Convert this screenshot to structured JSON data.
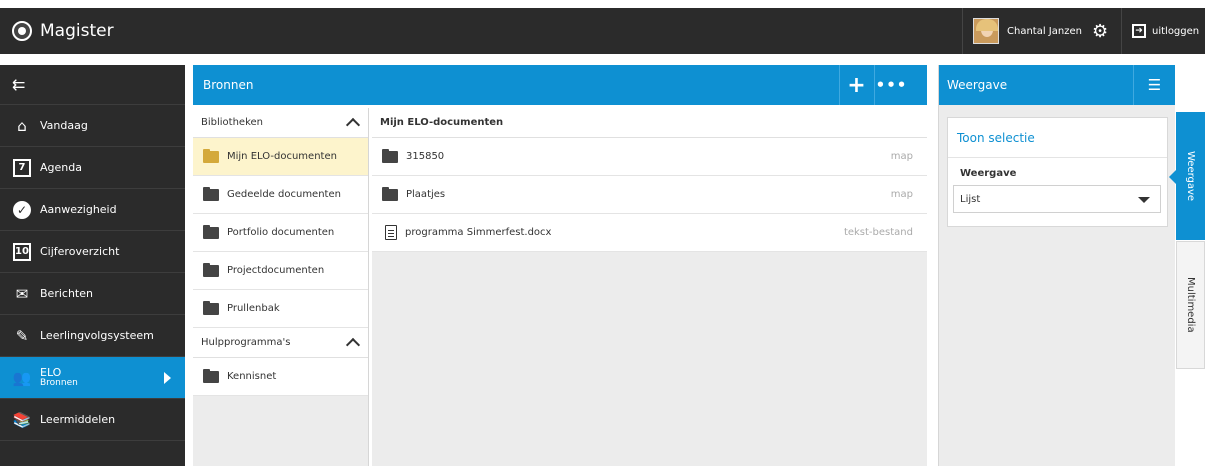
{
  "app": {
    "title": "Magister"
  },
  "user": {
    "name": "Chantal Janzen",
    "logout_label": "uitloggen"
  },
  "sidebar": {
    "items": [
      {
        "label": "Vandaag",
        "icon": "house-icon"
      },
      {
        "label": "Agenda",
        "icon": "calendar-7-icon",
        "badge": "7"
      },
      {
        "label": "Aanwezigheid",
        "icon": "check-circle-icon"
      },
      {
        "label": "Cijferoverzicht",
        "icon": "grade-10-icon",
        "badge": "10"
      },
      {
        "label": "Berichten",
        "icon": "envelope-icon"
      },
      {
        "label": "Leerlingvolgsysteem",
        "icon": "notebook-pen-icon"
      },
      {
        "label": "ELO",
        "sublabel": "Bronnen",
        "icon": "people-icon",
        "active": true
      },
      {
        "label": "Leermiddelen",
        "icon": "books-icon"
      }
    ]
  },
  "bronnen": {
    "title": "Bronnen",
    "libraries": {
      "header": "Bibliotheken",
      "items": [
        "Mijn ELO-documenten",
        "Gedeelde documenten",
        "Portfolio documenten",
        "Projectdocumenten",
        "Prullenbak"
      ]
    },
    "tools": {
      "header": "Hulpprogramma's",
      "items": [
        "Kennisnet"
      ]
    },
    "files": {
      "header": "Mijn ELO-documenten",
      "rows": [
        {
          "name": "315850",
          "type": "map",
          "icon": "folder-icon"
        },
        {
          "name": "Plaatjes",
          "type": "map",
          "icon": "folder-icon"
        },
        {
          "name": "programma Simmerfest.docx",
          "type": "tekst-bestand",
          "icon": "document-icon"
        }
      ]
    }
  },
  "weergave": {
    "title": "Weergave",
    "toon_selectie": "Toon selectie",
    "label": "Weergave",
    "selected": "Lijst"
  },
  "side_tabs": {
    "weergave": "Weergave",
    "multimedia": "Multimedia"
  },
  "colors": {
    "accent": "#0e90d2",
    "dark": "#2b2b2b",
    "selected": "#fdf4cc"
  }
}
